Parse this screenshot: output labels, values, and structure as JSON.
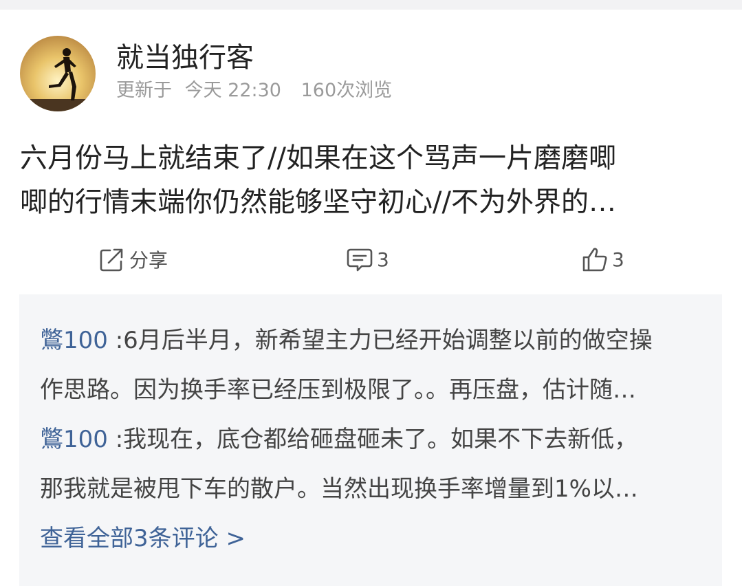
{
  "post": {
    "author_name": "就当独行客",
    "updated_prefix": "更新于",
    "updated_time": "今天 22:30",
    "views": "160次浏览",
    "text_lines": [
      "六月份马上就结束了//如果在这个骂声一片磨磨唧",
      "唧的行情末端你仍然能够坚守初心//不为外界的…"
    ]
  },
  "actions": {
    "share_label": "分享",
    "comment_count": "3",
    "like_count": "3"
  },
  "comments": {
    "items": [
      {
        "author": "鷩100",
        "separator": " :",
        "line1": "6月后半月，新希望主力已经开始调整以前的做空操",
        "line2": "作思路。因为换手率已经压到极限了。。再压盘，估计随…"
      },
      {
        "author": "鷩100",
        "separator": " :",
        "line1": "我现在，底仓都给砸盘砸未了。如果不下去新低，",
        "line2": "那我就是被甩下车的散户。当然出现换手率增量到1%以…"
      }
    ],
    "view_all": "查看全部3条评论 >"
  },
  "colors": {
    "link_blue": "#3f6397",
    "meta_gray": "#9a9a9a",
    "comment_bg": "#f5f6f8"
  },
  "icons": [
    "avatar-runner-silhouette",
    "share-icon",
    "comment-icon",
    "thumbs-up-icon"
  ]
}
